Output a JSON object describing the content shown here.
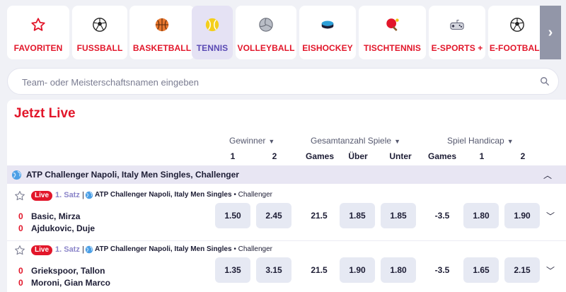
{
  "sports": [
    {
      "label": "FAVORITEN",
      "icon": "star-icon",
      "active": false
    },
    {
      "label": "FUSSBALL",
      "icon": "soccer-ball-icon",
      "active": false
    },
    {
      "label": "BASKETBALL",
      "icon": "basketball-icon",
      "active": false
    },
    {
      "label": "TENNIS",
      "icon": "tennis-ball-icon",
      "active": true
    },
    {
      "label": "VOLLEYBALL",
      "icon": "volleyball-icon",
      "active": false
    },
    {
      "label": "EISHOCKEY",
      "icon": "hockey-puck-icon",
      "active": false
    },
    {
      "label": "TISCHTENNIS",
      "icon": "ping-pong-icon",
      "active": false
    },
    {
      "label": "E-SPORTS +",
      "icon": "gamepad-icon",
      "active": false
    },
    {
      "label": "E-FOOTBALL",
      "icon": "soccer-ball-icon",
      "active": false
    }
  ],
  "search": {
    "placeholder": "Team- oder Meisterschaftsnamen eingeben"
  },
  "live": {
    "title": "Jetzt Live",
    "markets": {
      "winner": "Gewinner",
      "total": "Gesamtanzahl Spiele",
      "handicap": "Spiel Handicap"
    },
    "subheaders": {
      "w1": "1",
      "w2": "2",
      "games": "Games",
      "over": "Über",
      "under": "Unter",
      "h_games": "Games",
      "h1": "1",
      "h2": "2"
    },
    "league": "ATP Challenger Napoli, Italy Men Singles, Challenger",
    "matches": [
      {
        "live": "Live",
        "set": "1. Satz",
        "sep": "|",
        "league_bold": "ATP Challenger Napoli, Italy Men Singles",
        "league_rest": " • Challenger",
        "home": {
          "score": "0",
          "name": "Basic, Mirza"
        },
        "away": {
          "score": "0",
          "name": "Ajdukovic, Duje"
        },
        "w1": "1.50",
        "w2": "2.45",
        "total_games": "21.5",
        "over": "1.85",
        "under": "1.85",
        "hcp_games": "-3.5",
        "h1": "1.80",
        "h2": "1.90"
      },
      {
        "live": "Live",
        "set": "1. Satz",
        "sep": "|",
        "league_bold": "ATP Challenger Napoli, Italy Men Singles",
        "league_rest": " • Challenger",
        "home": {
          "score": "0",
          "name": "Griekspoor, Tallon"
        },
        "away": {
          "score": "0",
          "name": "Moroni, Gian Marco"
        },
        "w1": "1.35",
        "w2": "3.15",
        "total_games": "21.5",
        "over": "1.90",
        "under": "1.80",
        "hcp_games": "-3.5",
        "h1": "1.65",
        "h2": "2.15"
      }
    ]
  },
  "colors": {
    "brand_red": "#e2162a",
    "accent_purple": "#5a4ab4",
    "odd_bg": "#e6e9f3"
  }
}
